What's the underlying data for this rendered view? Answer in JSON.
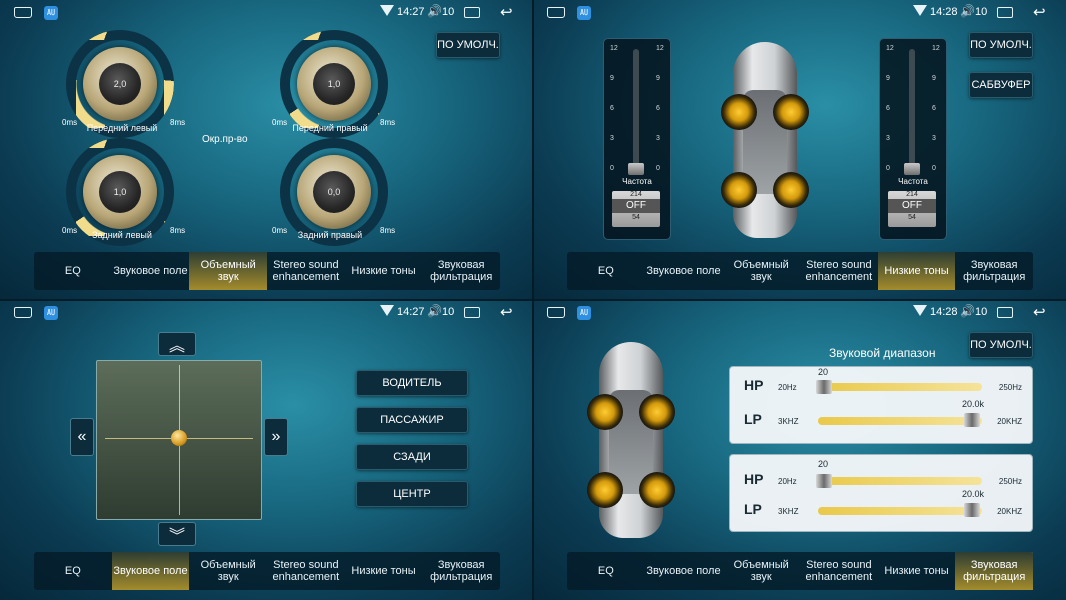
{
  "status": {
    "time1": "14:27",
    "time2": "14:28",
    "volume": "10",
    "volume_icon": "🔊",
    "back_icon": "↩",
    "app_icon": "㍳"
  },
  "tabs": [
    "EQ",
    "Звуковое поле",
    "Объемный звук",
    "Stereo sound enhancement",
    "Низкие тоны",
    "Звуковая фильтрация"
  ],
  "surround": {
    "default_button": "ПО УМОЛЧ.",
    "center_label": "Окр.пр-во",
    "knobs": [
      {
        "label": "Передний левый",
        "value": "2,0",
        "min": "0ms",
        "max": "8ms",
        "level": 0.25
      },
      {
        "label": "Передний правый",
        "value": "1,0",
        "min": "0ms",
        "max": "8ms",
        "level": 0.12
      },
      {
        "label": "Задний левый",
        "value": "1,0",
        "min": "0ms",
        "max": "8ms",
        "level": 0.12
      },
      {
        "label": "Задний правый",
        "value": "0,0",
        "min": "0ms",
        "max": "8ms",
        "level": 0.0
      }
    ],
    "active_tab": 2
  },
  "bass": {
    "default_button": "ПО УМОЛЧ.",
    "subwoofer_button": "САБВУФЕР",
    "sliders": [
      {
        "freq_label": "Частота",
        "top": "214",
        "mid": "OFF",
        "bottom": "54",
        "level": 0
      },
      {
        "freq_label": "Частота",
        "top": "214",
        "mid": "OFF",
        "bottom": "54",
        "level": 0
      }
    ],
    "ticks": [
      "12",
      "9",
      "6",
      "3",
      "0"
    ],
    "active_tab": 4
  },
  "field": {
    "buttons": [
      "ВОДИТЕЛЬ",
      "ПАССАЖИР",
      "СЗАДИ",
      "ЦЕНТР"
    ],
    "up": "︽",
    "down": "︾",
    "left": "«",
    "right": "»",
    "active_tab": 1
  },
  "filter": {
    "default_button": "ПО УМОЛЧ.",
    "title": "Звуковой диапазон",
    "groups": [
      {
        "hp_label": "HP",
        "hp_min": "20Hz",
        "hp_max": "250Hz",
        "hp_value": "20",
        "lp_label": "LP",
        "lp_min": "3KHZ",
        "lp_max": "20KHZ",
        "lp_value": "20.0k"
      },
      {
        "hp_label": "HP",
        "hp_min": "20Hz",
        "hp_max": "250Hz",
        "hp_value": "20",
        "lp_label": "LP",
        "lp_min": "3KHZ",
        "lp_max": "20KHZ",
        "lp_value": "20.0k"
      }
    ],
    "active_tab": 5
  }
}
